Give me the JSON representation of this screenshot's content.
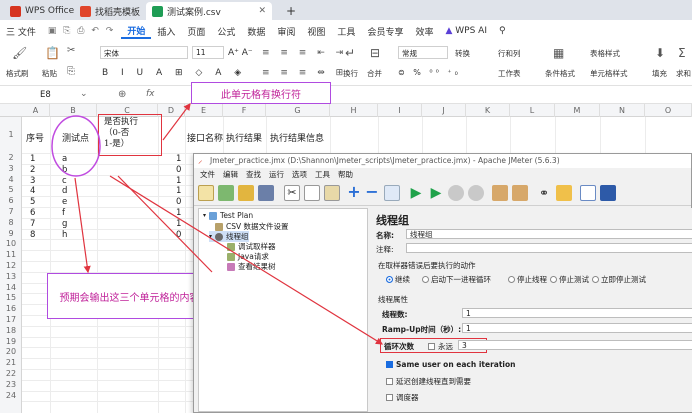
{
  "titlebar": {
    "tabs": [
      {
        "label": "WPS Office",
        "color": "#d6341f"
      },
      {
        "label": "找稻壳模板",
        "color": "#e0452b"
      },
      {
        "label": "测试案例.csv",
        "color": "#1f9d55"
      }
    ],
    "add_tab": "+"
  },
  "menubar": {
    "file": "三 文件",
    "items": [
      "开始",
      "插入",
      "页面",
      "公式",
      "数据",
      "审阅",
      "视图",
      "工具",
      "会员专享",
      "效率"
    ],
    "wps_ai": "WPS AI"
  },
  "ribbon": {
    "format_painter": "格式刷",
    "paste": "粘贴",
    "font_name": "宋体",
    "font_size": "11",
    "wrap": "换行",
    "merge": "合并",
    "number_format": "常规",
    "convert": "转换",
    "row_col": "行和列",
    "worksheet": "工作表",
    "cond_format": "条件格式",
    "table_style": "表格样式",
    "cell_style": "单元格样式",
    "fill": "填充",
    "sum": "求和"
  },
  "formula_bar": {
    "cell_ref": "E8",
    "fx": "fx"
  },
  "sheet": {
    "columns": [
      "A",
      "B",
      "C",
      "D",
      "E",
      "F",
      "G",
      "H",
      "I",
      "J",
      "K",
      "L",
      "M",
      "N",
      "O"
    ],
    "rows": [
      "1",
      "2",
      "3",
      "4",
      "5",
      "6",
      "7",
      "8",
      "9",
      "10",
      "11",
      "12",
      "13",
      "14",
      "15",
      "16",
      "17",
      "18",
      "19",
      "20",
      "21",
      "22",
      "23",
      "24"
    ],
    "headers": {
      "a1": "序号",
      "b1": "测试点",
      "c1": "是否执行\n（0-否\n1-是）",
      "d1": "接口名称",
      "e1": "执行结果",
      "f1": "执行结果信息"
    },
    "data_rows": [
      {
        "a": "1",
        "b": "a",
        "c": "1"
      },
      {
        "a": "2",
        "b": "b",
        "c": "0"
      },
      {
        "a": "3",
        "b": "c",
        "c": "1"
      },
      {
        "a": "4",
        "b": "d",
        "c": "1"
      },
      {
        "a": "5",
        "b": "e",
        "c": "0"
      },
      {
        "a": "6",
        "b": "f",
        "c": "1"
      },
      {
        "a": "7",
        "b": "g",
        "c": "1"
      },
      {
        "a": "8",
        "b": "h",
        "c": "0"
      }
    ]
  },
  "annotations": {
    "newline_note": "此单元格有换行符",
    "expect_note": "预期会输出这三个单元格的内容",
    "annotation_color": "#b04be0",
    "arrow_color": "#e0343f"
  },
  "jmeter": {
    "title": "Jmeter_practice.jmx (D:\\Shannon\\Jmeter_scripts\\Jmeter_practice.jmx) - Apache JMeter (5.6.3)",
    "menu": [
      "文件",
      "编辑",
      "查找",
      "运行",
      "选项",
      "工具",
      "帮助"
    ],
    "tree": {
      "test_plan": "Test Plan",
      "csv_config": "CSV 数据文件设置",
      "thread_group": "线程组",
      "debug_sampler": "调试取样器",
      "java_request": "Java请求",
      "results_tree": "查看结果树"
    },
    "panel": {
      "heading": "线程组",
      "name_label": "名称:",
      "name_value": "线程组",
      "comment_label": "注释:",
      "error_action_title": "在取样器错误后要执行的动作",
      "error_actions": [
        "继续",
        "启动下一进程循环",
        "停止线程",
        "停止测试",
        "立即停止测试"
      ],
      "props_title": "线程属性",
      "threads_label": "线程数:",
      "threads_value": "1",
      "rampup_label": "Ramp-Up时间（秒）:",
      "rampup_value": "1",
      "loop_label": "循环次数",
      "forever_label": "永远",
      "loop_value": "3",
      "same_user": "Same user on each iteration",
      "delay_create": "延迟创建线程直到需要",
      "scheduler": "调度器"
    }
  }
}
